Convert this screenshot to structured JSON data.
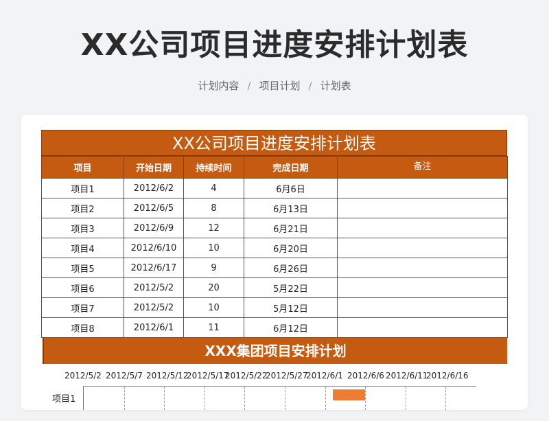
{
  "page": {
    "title": "XX公司项目进度安排计划表",
    "breadcrumb": [
      "计划内容",
      "项目计划",
      "计划表"
    ],
    "accent_color": "#c55a11"
  },
  "sheet": {
    "title": "XX公司项目进度安排计划表",
    "headers": [
      "项目",
      "开始日期",
      "持续时间",
      "完成日期",
      "备注"
    ],
    "rows": [
      [
        "项目1",
        "2012/6/2",
        "4",
        "6月6日",
        ""
      ],
      [
        "项目2",
        "2012/6/5",
        "8",
        "6月13日",
        ""
      ],
      [
        "项目3",
        "2012/6/9",
        "12",
        "6月21日",
        ""
      ],
      [
        "项目4",
        "2012/6/10",
        "10",
        "6月20日",
        ""
      ],
      [
        "项目5",
        "2012/6/17",
        "9",
        "6月26日",
        ""
      ],
      [
        "项目6",
        "2012/5/2",
        "20",
        "5月22日",
        ""
      ],
      [
        "项目7",
        "2012/5/2",
        "10",
        "5月12日",
        ""
      ],
      [
        "项目8",
        "2012/6/1",
        "11",
        "6月12日",
        ""
      ]
    ]
  },
  "gantt": {
    "title": "XXX集团项目安排计划",
    "tick_labels": [
      "2012/5/2",
      "2012/5/7",
      "2012/5/12",
      "2012/5/17",
      "2012/5/22",
      "2012/5/27",
      "2012/6/1",
      "2012/6/6",
      "2012/6/11",
      "2012/6/16"
    ],
    "visible_rows": [
      {
        "label": "项目1",
        "start": "2012/6/2",
        "duration": 4
      }
    ],
    "bar_color": "#ed7d31"
  }
}
